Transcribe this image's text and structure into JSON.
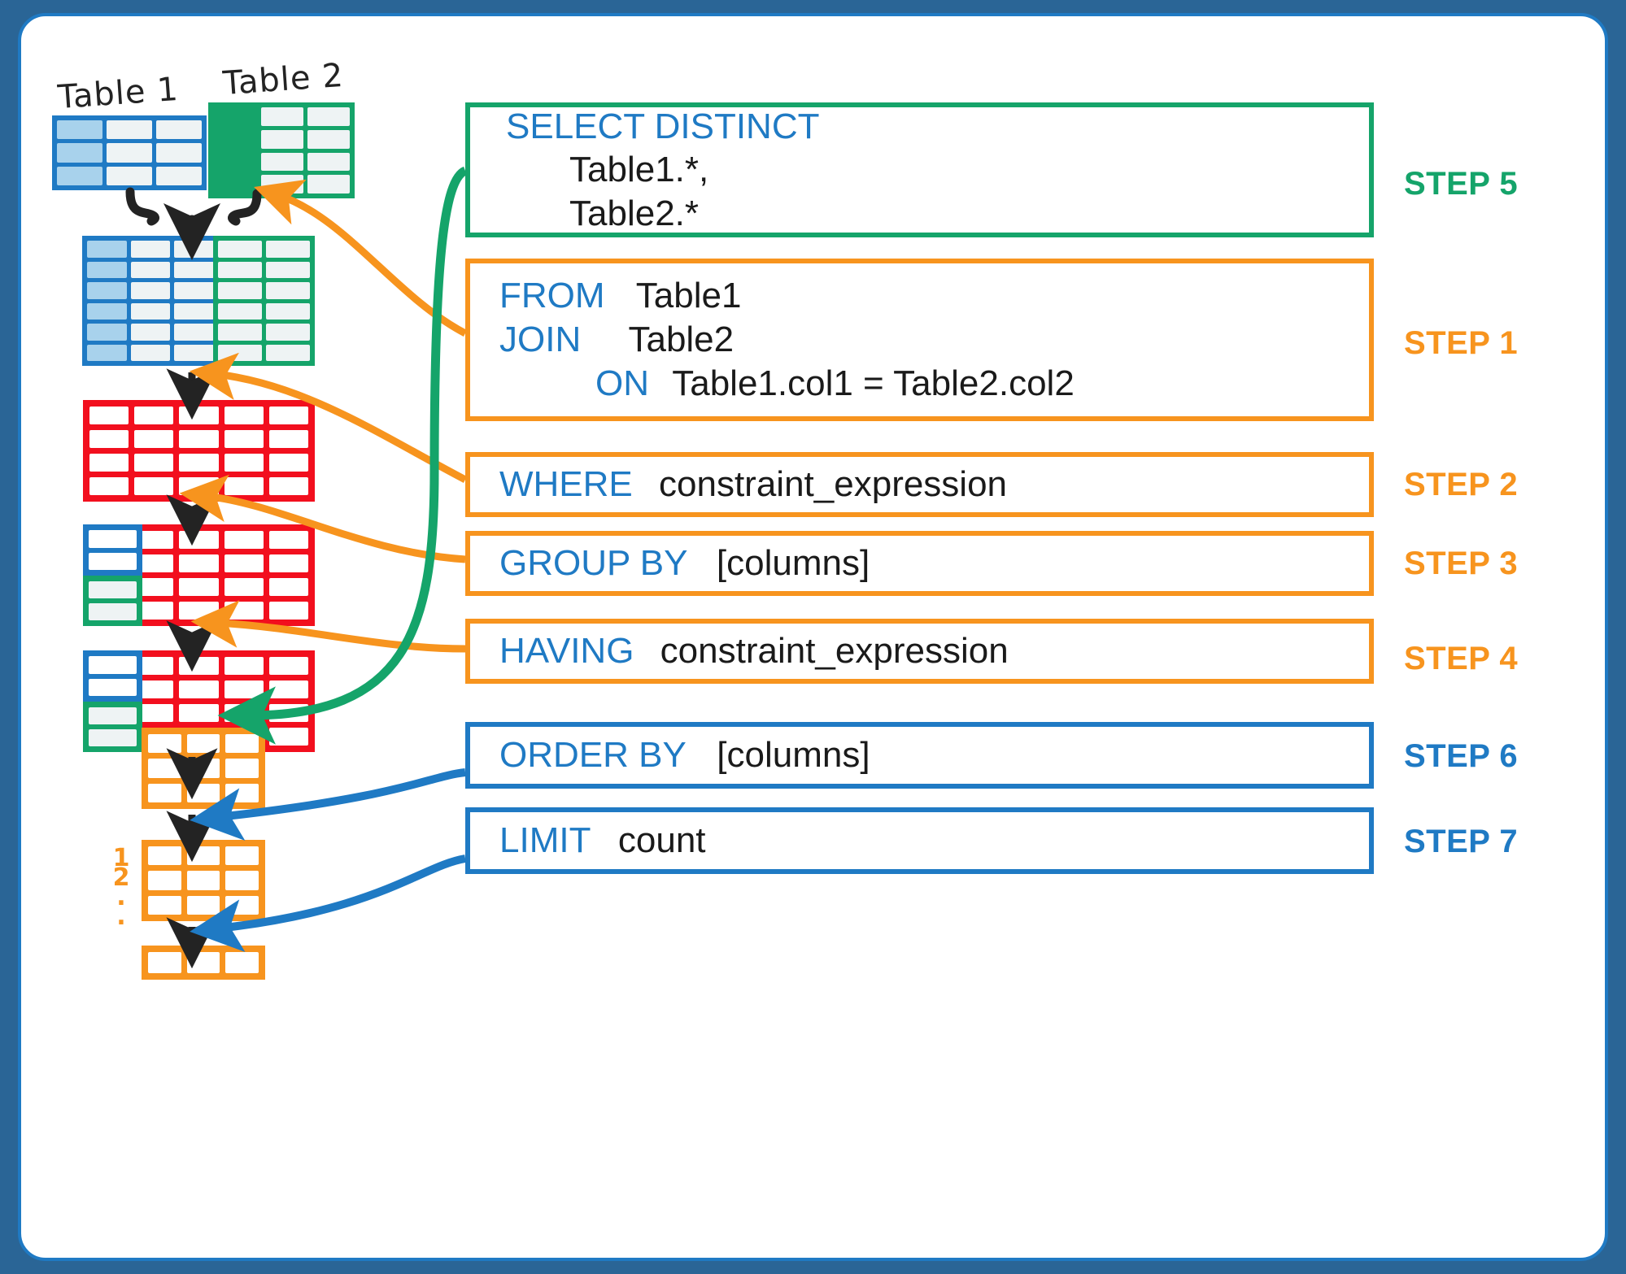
{
  "title": "SQL query execution order diagram",
  "captions": {
    "table1": "Table 1",
    "table2": "Table 2"
  },
  "row_numbers": [
    "1",
    "2",
    ".",
    "."
  ],
  "colors": {
    "frame": "#2a6596",
    "blue": "#1f7ac4",
    "green": "#15a46a",
    "red": "#f20f1e",
    "orange": "#f7941e",
    "black": "#232323",
    "cell_fill": "#eef3f4",
    "blue_fill": "#a8d2ec"
  },
  "clauses": [
    {
      "id": "select",
      "color": "green",
      "step": "STEP 5",
      "step_color": "green",
      "lines": [
        {
          "keyword": "SELECT DISTINCT",
          "value": "",
          "indent": 0
        },
        {
          "keyword": "",
          "value": "Table1.*,",
          "indent": 1
        },
        {
          "keyword": "",
          "value": "Table2.*",
          "indent": 1
        }
      ]
    },
    {
      "id": "from",
      "color": "orange",
      "step": "STEP 1",
      "step_color": "orange",
      "lines": [
        {
          "keyword": "FROM",
          "value": "Table1",
          "indent": 0
        },
        {
          "keyword": "JOIN",
          "value": "Table2",
          "indent": 0
        },
        {
          "keyword": "ON",
          "value": "Table1.col1 = Table2.col2",
          "indent": 2
        }
      ]
    },
    {
      "id": "where",
      "color": "orange",
      "step": "STEP 2",
      "step_color": "orange",
      "lines": [
        {
          "keyword": "WHERE",
          "value": "constraint_expression",
          "indent": 0
        }
      ]
    },
    {
      "id": "groupby",
      "color": "orange",
      "step": "STEP 3",
      "step_color": "orange",
      "lines": [
        {
          "keyword": "GROUP BY",
          "value": "[columns]",
          "indent": 0
        }
      ]
    },
    {
      "id": "having",
      "color": "orange",
      "step": "STEP 4",
      "step_color": "orange",
      "lines": [
        {
          "keyword": "HAVING",
          "value": "constraint_expression",
          "indent": 0
        }
      ]
    },
    {
      "id": "orderby",
      "color": "blue",
      "step": "STEP 6",
      "step_color": "blue",
      "lines": [
        {
          "keyword": "ORDER BY",
          "value": "[columns]",
          "indent": 0
        }
      ]
    },
    {
      "id": "limit",
      "color": "blue",
      "step": "STEP 7",
      "step_color": "blue",
      "lines": [
        {
          "keyword": "LIMIT",
          "value": "count",
          "indent": 0
        }
      ]
    }
  ],
  "steps": {
    "select": "STEP 5",
    "from": "STEP 1",
    "where": "STEP 2",
    "groupby": "STEP 3",
    "having": "STEP 4",
    "orderby": "STEP 6",
    "limit": "STEP 7"
  },
  "clause_text": {
    "select_kw": "SELECT DISTINCT",
    "select_l2": "Table1.*,",
    "select_l3": "Table2.*",
    "from_kw": "FROM",
    "from_val": "Table1",
    "join_kw": "JOIN",
    "join_val": "Table2",
    "on_kw": "ON",
    "on_val": "Table1.col1 = Table2.col2",
    "where_kw": "WHERE",
    "where_val": "constraint_expression",
    "groupby_kw": "GROUP BY",
    "groupby_val": "[columns]",
    "having_kw": "HAVING",
    "having_val": "constraint_expression",
    "orderby_kw": "ORDER BY",
    "orderby_val": "[columns]",
    "limit_kw": "LIMIT",
    "limit_val": "count"
  }
}
